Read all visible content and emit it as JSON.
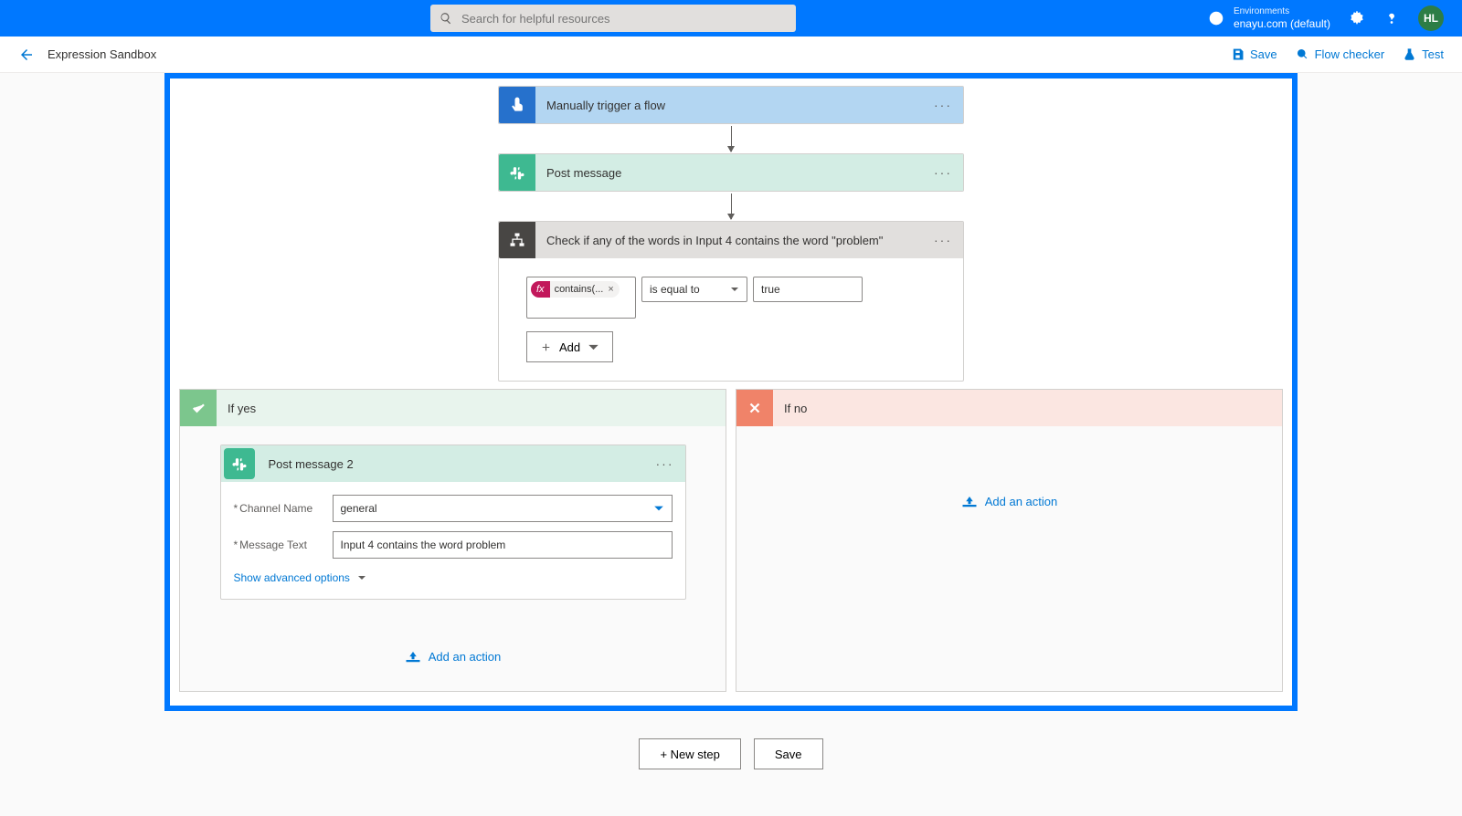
{
  "header": {
    "search_placeholder": "Search for helpful resources",
    "env_label": "Environments",
    "env_name": "enayu.com (default)",
    "avatar": "HL"
  },
  "toolbar": {
    "title": "Expression Sandbox",
    "save": "Save",
    "checker": "Flow checker",
    "test": "Test"
  },
  "flow": {
    "trigger": "Manually trigger a flow",
    "post_msg": "Post message",
    "condition": {
      "title": "Check if any of the words in Input 4 contains the word \"problem\"",
      "expr_pill": "contains(...",
      "operator": "is equal to",
      "value": "true",
      "add": "Add"
    },
    "yes": {
      "label": "If yes",
      "action": {
        "title": "Post message 2",
        "channel_label": "Channel Name",
        "channel_value": "general",
        "msg_label": "Message Text",
        "msg_value": "Input 4 contains the word problem",
        "advanced": "Show advanced options"
      },
      "add_action": "Add an action"
    },
    "no": {
      "label": "If no",
      "add_action": "Add an action"
    }
  },
  "bottom": {
    "new_step": "+ New step",
    "save": "Save"
  }
}
